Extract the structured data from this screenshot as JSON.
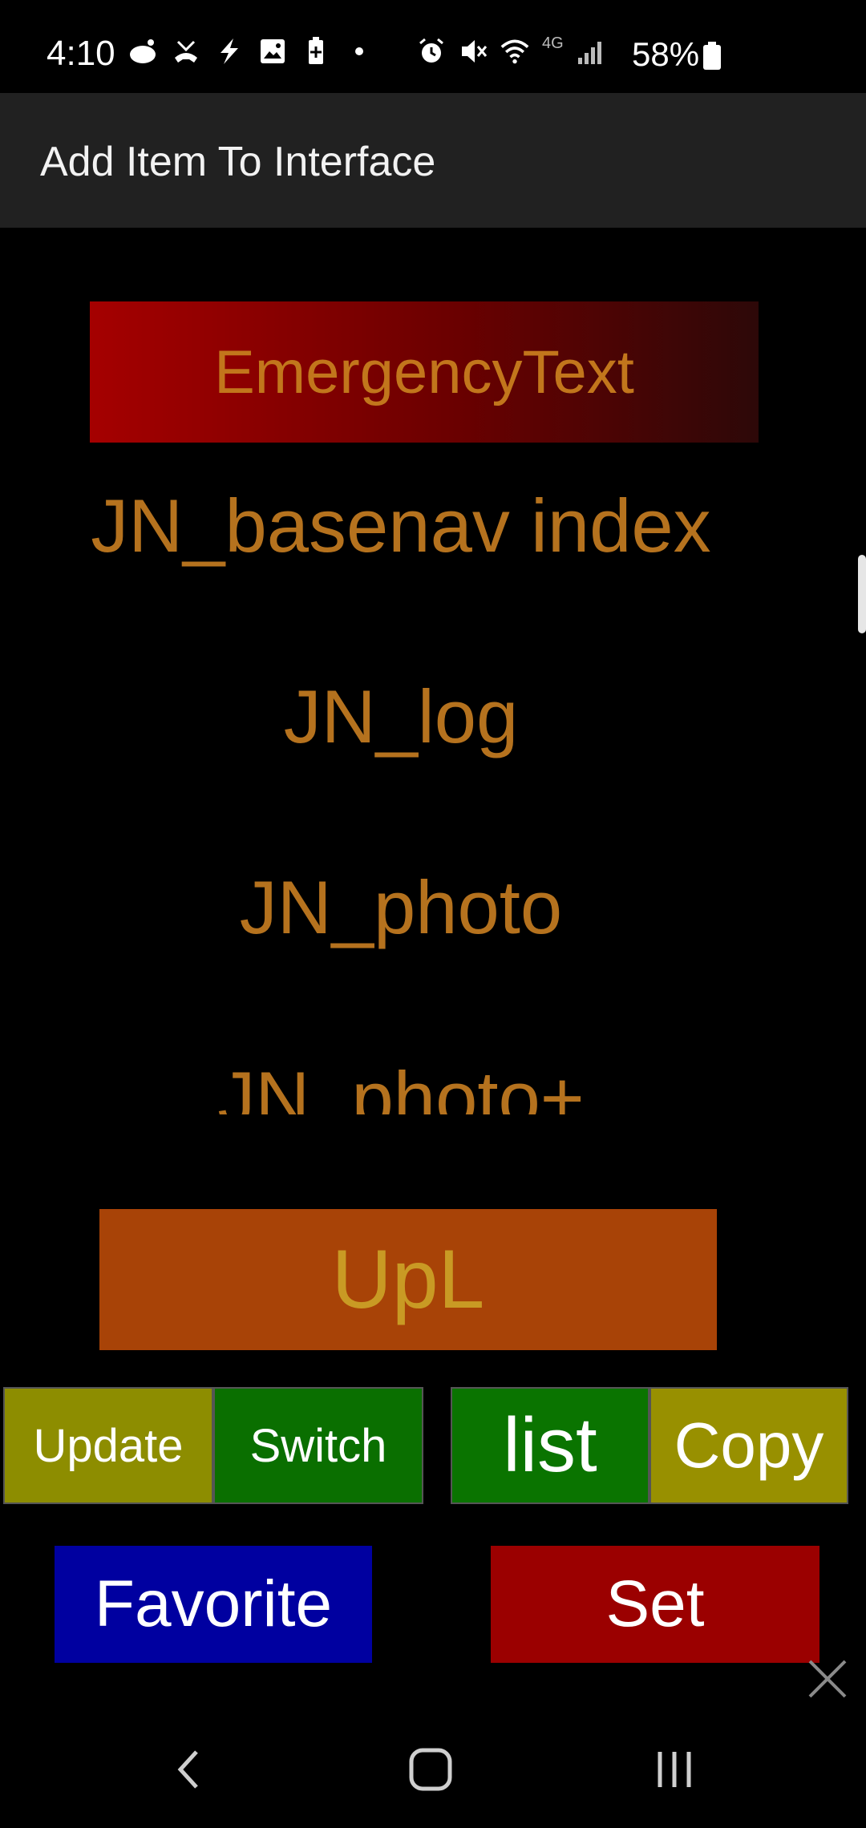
{
  "status_bar": {
    "time": "4:10",
    "battery_percent": "58%",
    "network_label": "4G"
  },
  "app_bar": {
    "title": "Add Item To Interface"
  },
  "list": {
    "emergency_label": "EmergencyText",
    "items": [
      "JN_basenav index",
      "JN_log",
      "JN_photo",
      "JN_photo+"
    ]
  },
  "buttons": {
    "upl": "UpL",
    "update": "Update",
    "switch": "Switch",
    "list": "list",
    "copy": "Copy",
    "favorite": "Favorite",
    "set": "Set"
  },
  "colors": {
    "item_text": "#b5721e",
    "emergency_gradient_start": "#a50000",
    "upl_bg": "#a84307",
    "update_bg": "#8d8d00",
    "switch_bg": "#0a6f00",
    "list_bg": "#0a7400",
    "copy_bg": "#989000",
    "favorite_bg": "#0000a0",
    "set_bg": "#9b0000"
  },
  "icons": {
    "status_left": [
      "reddit-icon",
      "missed-call-icon",
      "bolt-icon",
      "image-icon",
      "battery-plus-icon",
      "dot-icon"
    ],
    "status_right": [
      "alarm-icon",
      "mute-icon",
      "wifi-icon",
      "signal-icon",
      "battery-icon"
    ],
    "nav": [
      "back-icon",
      "home-icon",
      "recents-icon"
    ]
  }
}
